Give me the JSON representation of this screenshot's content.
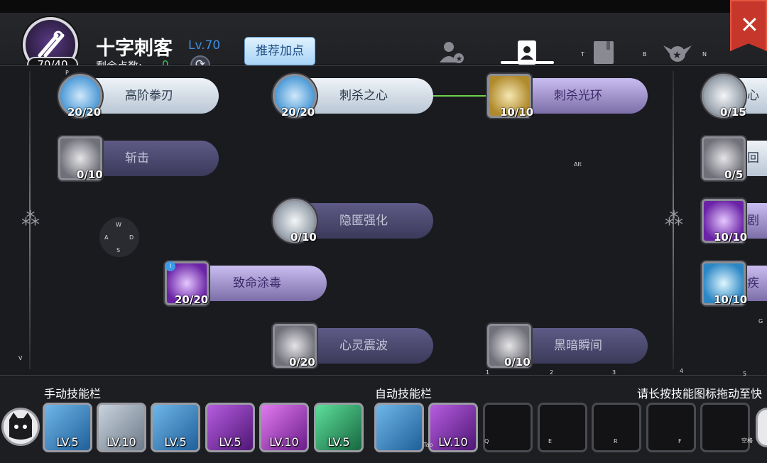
{
  "header": {
    "class_name": "十字刺客",
    "level": "Lv.70",
    "remaining_points_label": "剩余点数:",
    "remaining_points_value": "0",
    "points_badge": "70/40",
    "recommend_button": "推荐加点",
    "tab_keys": [
      "T",
      "B",
      "N"
    ]
  },
  "hotkeys": {
    "p": "P",
    "v": "V",
    "alt": "Alt",
    "g": "G",
    "tab": "Tab",
    "space": "空格"
  },
  "wasd": {
    "w": "W",
    "a": "A",
    "s": "S",
    "d": "D"
  },
  "column_keys": [
    "1",
    "2",
    "3",
    "4",
    "5"
  ],
  "skills": [
    {
      "name": "高阶拳刃",
      "count": "20/20"
    },
    {
      "name": "斩击",
      "count": "0/10"
    },
    {
      "name": "刺杀之心",
      "count": "20/20"
    },
    {
      "name": "隐匿强化",
      "count": "0/10"
    },
    {
      "name": "致命涂毒",
      "count": "20/20"
    },
    {
      "name": "心灵震波",
      "count": "0/20"
    },
    {
      "name": "刺杀光环",
      "count": "10/10"
    },
    {
      "name": "黑暗瞬间",
      "count": "0/10"
    },
    {
      "name": "心灵",
      "count": "0/15"
    },
    {
      "name": "回旋",
      "count": "0/5"
    },
    {
      "name": "剧毒",
      "count": "10/10"
    },
    {
      "name": "疾风",
      "count": "10/10"
    }
  ],
  "bottom": {
    "manual_title": "手动技能栏",
    "auto_title": "自动技能栏",
    "hint": "请长按技能图标拖动至快",
    "manual_slots": [
      "LV.5",
      "LV.10",
      "LV.5",
      "LV.5",
      "LV.10",
      "LV.5"
    ],
    "auto_slots": [
      "",
      "LV.10"
    ],
    "empty_slot_keys": [
      "Q",
      "E",
      "R",
      "F",
      ""
    ]
  },
  "colors": {
    "accent_blue": "#3f8fe0",
    "green_value": "#37c75b",
    "close_red": "#c6362a"
  }
}
